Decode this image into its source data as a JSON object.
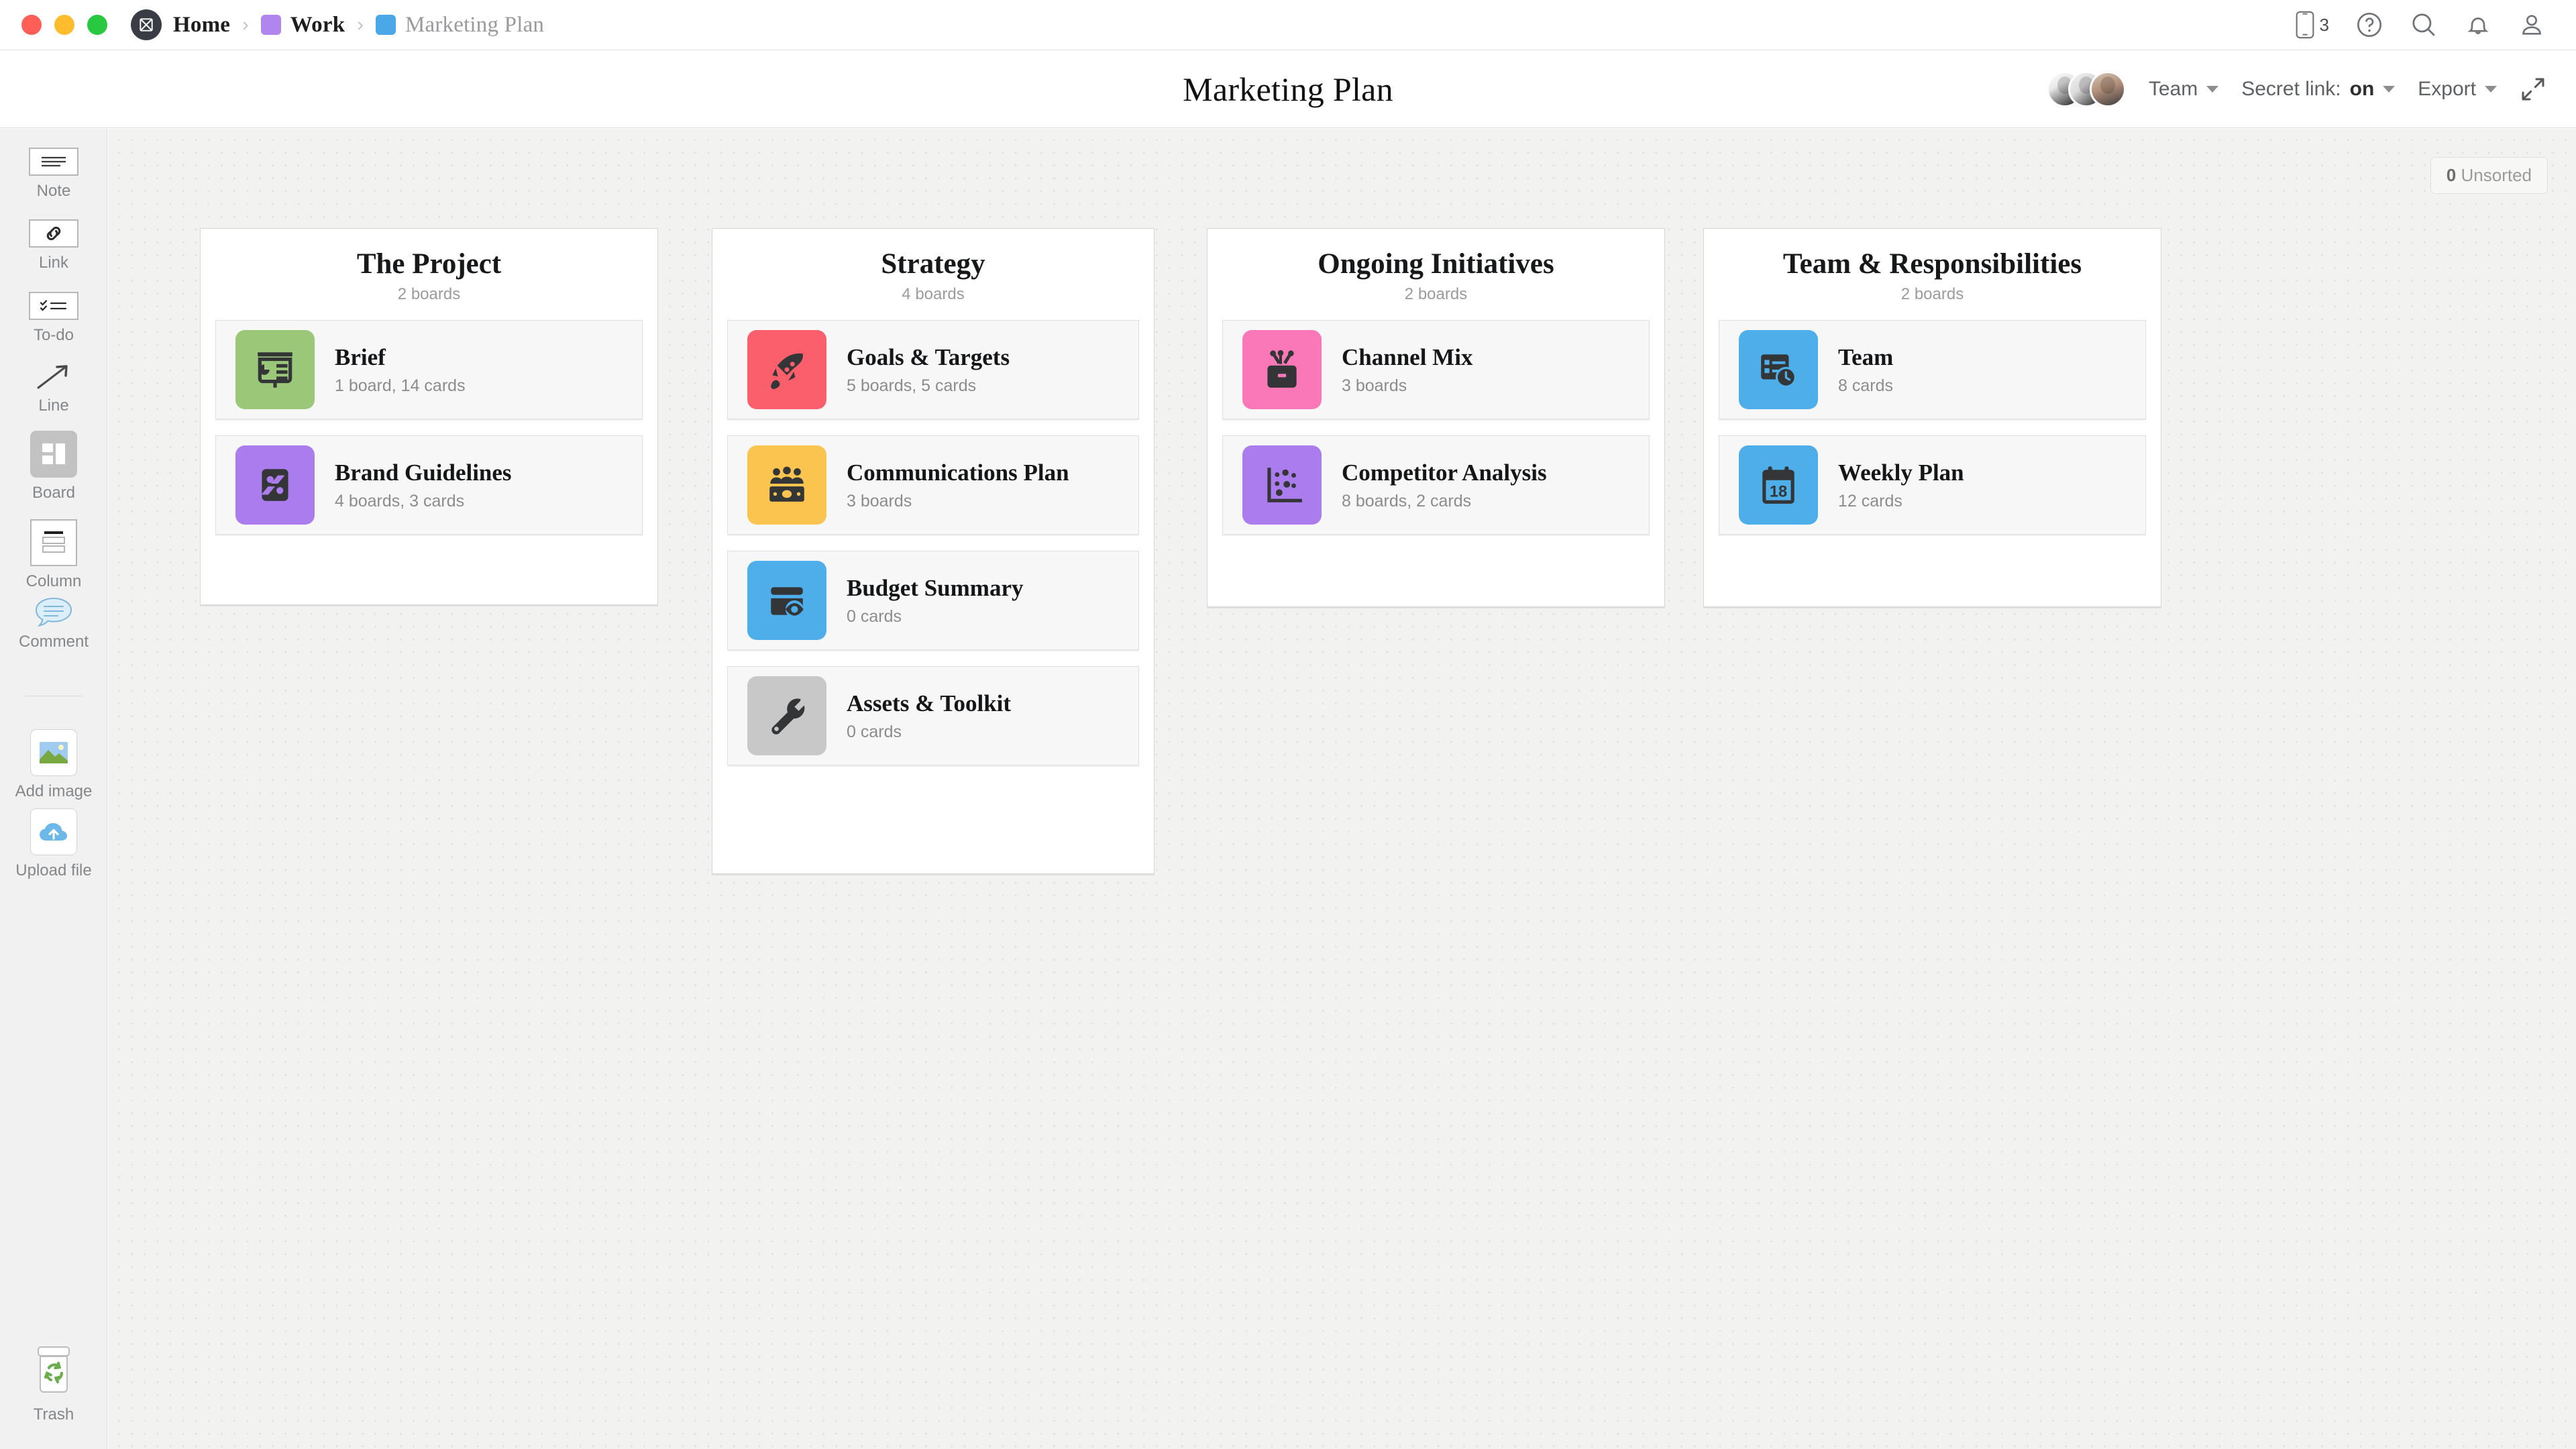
{
  "titlebar": {
    "breadcrumb": [
      {
        "label": "Home",
        "icon": "app-logo-icon",
        "swatch": null,
        "current": false
      },
      {
        "label": "Work",
        "icon": null,
        "swatch": "#b085ed",
        "current": false
      },
      {
        "label": "Marketing Plan",
        "icon": null,
        "swatch": "#4aa8e8",
        "current": true
      }
    ],
    "separator": "›",
    "right_icons": [
      {
        "name": "mobile-icon",
        "badge": "3"
      },
      {
        "name": "help-icon",
        "badge": null
      },
      {
        "name": "search-icon",
        "badge": null
      },
      {
        "name": "notifications-icon",
        "badge": null
      },
      {
        "name": "account-icon",
        "badge": null
      }
    ]
  },
  "header": {
    "title": "Marketing Plan",
    "team_label": "Team",
    "secret_link_label": "Secret link:",
    "secret_link_value": "on",
    "export_label": "Export",
    "avatars_count": 3
  },
  "toolbar": {
    "items": [
      {
        "label": "Note",
        "icon": "note-icon"
      },
      {
        "label": "Link",
        "icon": "link-icon"
      },
      {
        "label": "To-do",
        "icon": "todo-icon"
      },
      {
        "label": "Line",
        "icon": "line-arrow-icon"
      },
      {
        "label": "Board",
        "icon": "board-icon"
      },
      {
        "label": "Column",
        "icon": "column-icon"
      },
      {
        "label": "Comment",
        "icon": "comment-icon"
      },
      {
        "label": "Add image",
        "icon": "image-icon"
      },
      {
        "label": "Upload file",
        "icon": "cloud-upload-icon"
      },
      {
        "label": "Trash",
        "icon": "trash-icon"
      }
    ]
  },
  "canvas": {
    "unsorted_count": "0",
    "unsorted_label": "Unsorted",
    "columns": [
      {
        "title": "The Project",
        "subtitle": "2 boards",
        "boards": [
          {
            "name": "Brief",
            "meta": "1 board, 14 cards",
            "color": "#9ac878",
            "icon": "presentation-icon"
          },
          {
            "name": "Brand Guidelines",
            "meta": "4 boards, 3 cards",
            "color": "#ab7ced",
            "icon": "palette-icon"
          }
        ]
      },
      {
        "title": "Strategy",
        "subtitle": "4 boards",
        "boards": [
          {
            "name": "Goals & Targets",
            "meta": "5 boards, 5 cards",
            "color": "#fb5f6c",
            "icon": "rocket-icon"
          },
          {
            "name": "Communications Plan",
            "meta": "3 boards",
            "color": "#fbc44f",
            "icon": "money-people-icon"
          },
          {
            "name": "Budget Summary",
            "meta": "0 cards",
            "color": "#4eaeea",
            "icon": "wallet-eye-icon"
          },
          {
            "name": "Assets & Toolkit",
            "meta": "0 cards",
            "color": "#c8c8c8",
            "icon": "wrench-icon"
          }
        ]
      },
      {
        "title": "Ongoing Initiatives",
        "subtitle": "2 boards",
        "boards": [
          {
            "name": "Channel Mix",
            "meta": "3 boards",
            "color": "#fb78b8",
            "icon": "toolbox-icon"
          },
          {
            "name": "Competitor Analysis",
            "meta": "8 boards, 2 cards",
            "color": "#ab7ced",
            "icon": "scatter-chart-icon"
          }
        ]
      },
      {
        "title": "Team & Responsibilities",
        "subtitle": "2 boards",
        "boards": [
          {
            "name": "Team",
            "meta": "8 cards",
            "color": "#4eaeea",
            "icon": "schedule-icon"
          },
          {
            "name": "Weekly Plan",
            "meta": "12 cards",
            "color": "#4eaeea",
            "icon": "calendar-18-icon"
          }
        ]
      }
    ]
  }
}
